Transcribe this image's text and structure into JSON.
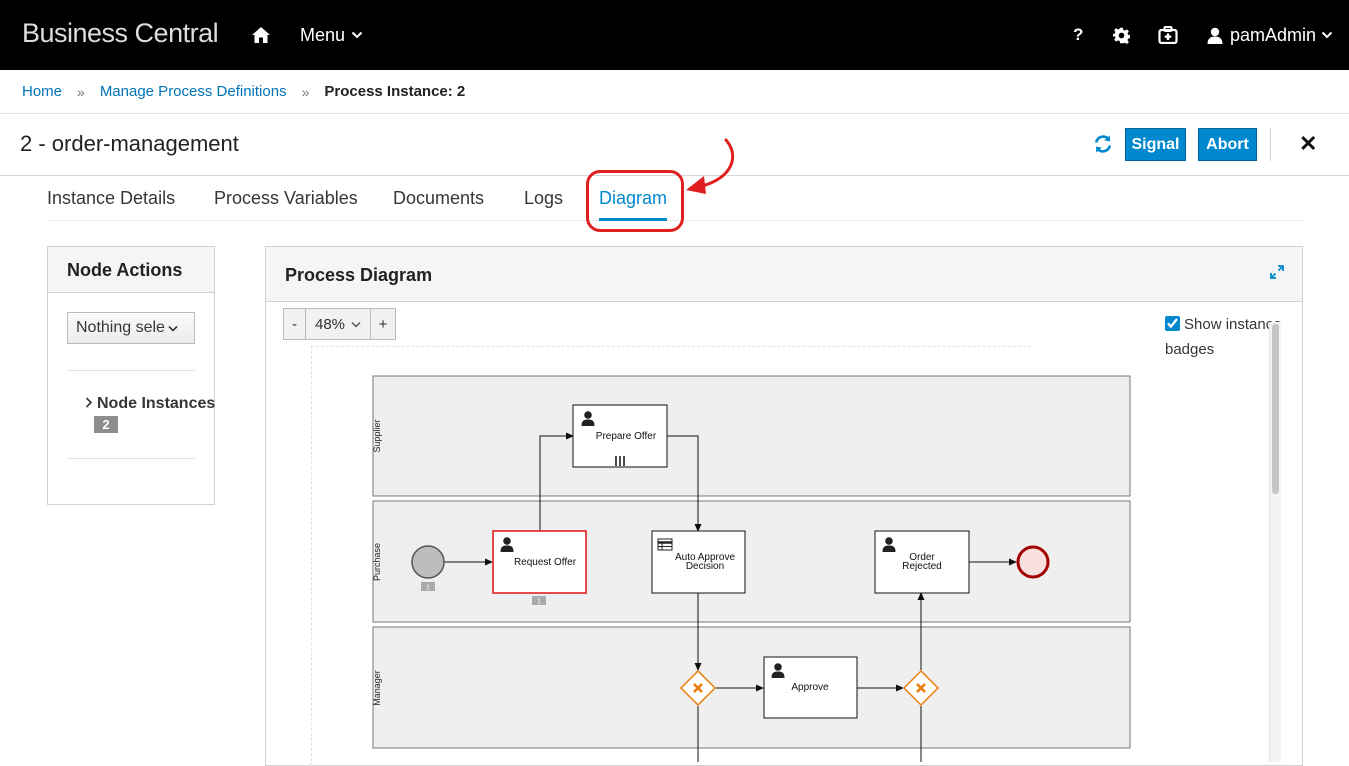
{
  "topbar": {
    "brand": "Business Central",
    "home_icon": "home-icon",
    "menu_label": "Menu",
    "help_label": "?",
    "user_label": "pamAdmin"
  },
  "breadcrumb": {
    "home": "Home",
    "manage": "Manage Process Definitions",
    "current": "Process Instance: 2",
    "sep": "»"
  },
  "instance": {
    "title": "2 - order-management",
    "signal_label": "Signal",
    "abort_label": "Abort",
    "close_glyph": "✕"
  },
  "tabs": [
    {
      "label": "Instance Details"
    },
    {
      "label": "Process Variables"
    },
    {
      "label": "Documents"
    },
    {
      "label": "Logs"
    },
    {
      "label": "Diagram"
    }
  ],
  "node_actions": {
    "title": "Node Actions",
    "select_value": "Nothing sele",
    "node_instances_label": "Node Instances",
    "node_instances_count": "2"
  },
  "diagram": {
    "title": "Process Diagram",
    "zoom_minus": "-",
    "zoom_value": "48%",
    "zoom_plus": "+",
    "show_badges_line1": "Show instance",
    "show_badges_line2": "badges",
    "show_badges_checked": true,
    "lanes": [
      "Supplier",
      "Purchase",
      "Manager"
    ],
    "nodes": {
      "prepare_offer": "Prepare Offer",
      "request_offer": "Request Offer",
      "auto_approve_1": "Auto Approve",
      "auto_approve_2": "Decision",
      "order_rejected_1": "Order",
      "order_rejected_2": "Rejected",
      "approve": "Approve"
    },
    "badges": {
      "start": "1",
      "request_offer": "1"
    }
  },
  "colors": {
    "accent": "#0088ce",
    "highlight": "#e02020",
    "gateway": "#ec7a08",
    "end_event": "#a30000"
  }
}
